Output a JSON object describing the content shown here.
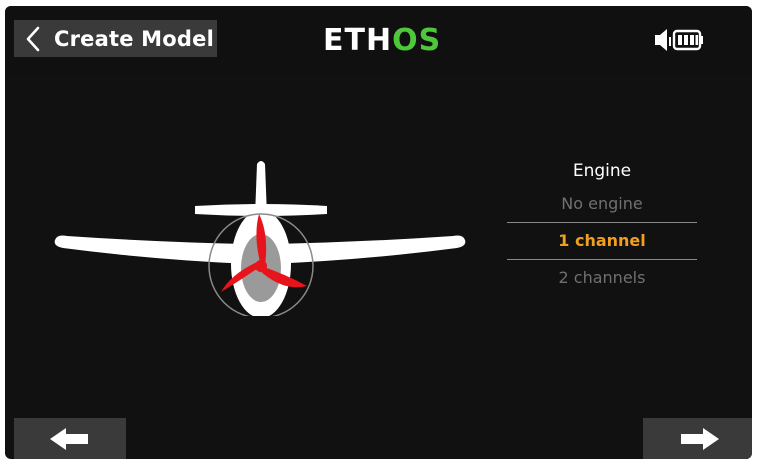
{
  "header": {
    "title": "Create Model",
    "brand_main": "ETH",
    "brand_accent": "OS",
    "back_icon": "chevron-left-icon",
    "speaker_icon": "speaker-icon",
    "battery_icon": "battery-icon"
  },
  "illustration": {
    "name": "airplane-front-view",
    "propeller_color": "#e8141c"
  },
  "picker": {
    "title": "Engine",
    "options": [
      "No engine",
      "1 channel",
      "2 channels"
    ],
    "selected": "1 channel"
  },
  "footer": {
    "prev_icon": "arrow-left-icon",
    "next_icon": "arrow-right-icon"
  },
  "colors": {
    "background": "#111111",
    "button_bg": "#3a3a3a",
    "accent_selected": "#f0a020",
    "brand_green": "#4ec83a"
  }
}
